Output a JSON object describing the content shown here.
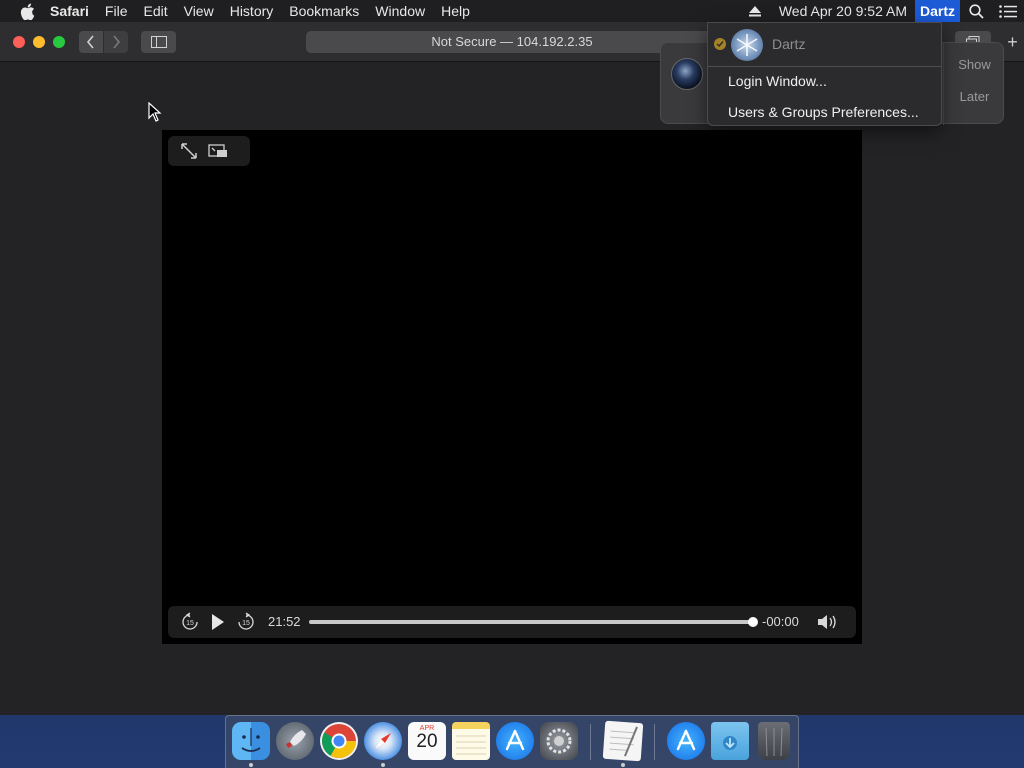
{
  "menubar": {
    "app_name": "Safari",
    "items": [
      "File",
      "Edit",
      "View",
      "History",
      "Bookmarks",
      "Window",
      "Help"
    ],
    "clock": "Wed Apr 20  9:52 AM",
    "user": "Dartz",
    "icons": [
      "apple-icon",
      "eject-icon",
      "spotlight-icon",
      "notification-center-icon"
    ]
  },
  "browser": {
    "address": "Not Secure — 104.192.2.35",
    "new_tab_label": "+"
  },
  "notification": {
    "actions": [
      "Show",
      "Later"
    ]
  },
  "user_menu": {
    "current_user": "Dartz",
    "items": [
      "Login Window...",
      "Users & Groups Preferences..."
    ]
  },
  "video": {
    "elapsed": "21:52",
    "remaining": "-00:00",
    "progress": 1.0,
    "controls": [
      "fullscreen-icon",
      "picture-in-picture-icon",
      "skip-back-15-icon",
      "play-icon",
      "skip-forward-15-icon",
      "volume-icon"
    ]
  },
  "dock": {
    "apps": [
      "Finder",
      "Launchpad",
      "Google Chrome",
      "Safari",
      "Calendar",
      "Notes",
      "App Store",
      "System Preferences",
      "TextEdit",
      "Applications",
      "Downloads",
      "Trash"
    ],
    "calendar_month": "APR",
    "calendar_day": "20"
  }
}
